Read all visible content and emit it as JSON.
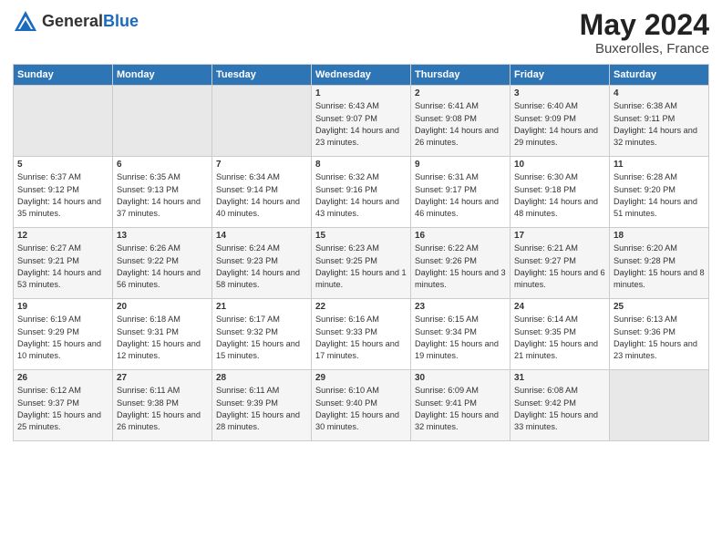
{
  "header": {
    "logo_general": "General",
    "logo_blue": "Blue",
    "month": "May 2024",
    "location": "Buxerolles, France"
  },
  "days_of_week": [
    "Sunday",
    "Monday",
    "Tuesday",
    "Wednesday",
    "Thursday",
    "Friday",
    "Saturday"
  ],
  "weeks": [
    [
      {
        "day": "",
        "sunrise": "",
        "sunset": "",
        "daylight": "",
        "empty": true
      },
      {
        "day": "",
        "sunrise": "",
        "sunset": "",
        "daylight": "",
        "empty": true
      },
      {
        "day": "",
        "sunrise": "",
        "sunset": "",
        "daylight": "",
        "empty": true
      },
      {
        "day": "1",
        "sunrise": "Sunrise: 6:43 AM",
        "sunset": "Sunset: 9:07 PM",
        "daylight": "Daylight: 14 hours and 23 minutes."
      },
      {
        "day": "2",
        "sunrise": "Sunrise: 6:41 AM",
        "sunset": "Sunset: 9:08 PM",
        "daylight": "Daylight: 14 hours and 26 minutes."
      },
      {
        "day": "3",
        "sunrise": "Sunrise: 6:40 AM",
        "sunset": "Sunset: 9:09 PM",
        "daylight": "Daylight: 14 hours and 29 minutes."
      },
      {
        "day": "4",
        "sunrise": "Sunrise: 6:38 AM",
        "sunset": "Sunset: 9:11 PM",
        "daylight": "Daylight: 14 hours and 32 minutes."
      }
    ],
    [
      {
        "day": "5",
        "sunrise": "Sunrise: 6:37 AM",
        "sunset": "Sunset: 9:12 PM",
        "daylight": "Daylight: 14 hours and 35 minutes."
      },
      {
        "day": "6",
        "sunrise": "Sunrise: 6:35 AM",
        "sunset": "Sunset: 9:13 PM",
        "daylight": "Daylight: 14 hours and 37 minutes."
      },
      {
        "day": "7",
        "sunrise": "Sunrise: 6:34 AM",
        "sunset": "Sunset: 9:14 PM",
        "daylight": "Daylight: 14 hours and 40 minutes."
      },
      {
        "day": "8",
        "sunrise": "Sunrise: 6:32 AM",
        "sunset": "Sunset: 9:16 PM",
        "daylight": "Daylight: 14 hours and 43 minutes."
      },
      {
        "day": "9",
        "sunrise": "Sunrise: 6:31 AM",
        "sunset": "Sunset: 9:17 PM",
        "daylight": "Daylight: 14 hours and 46 minutes."
      },
      {
        "day": "10",
        "sunrise": "Sunrise: 6:30 AM",
        "sunset": "Sunset: 9:18 PM",
        "daylight": "Daylight: 14 hours and 48 minutes."
      },
      {
        "day": "11",
        "sunrise": "Sunrise: 6:28 AM",
        "sunset": "Sunset: 9:20 PM",
        "daylight": "Daylight: 14 hours and 51 minutes."
      }
    ],
    [
      {
        "day": "12",
        "sunrise": "Sunrise: 6:27 AM",
        "sunset": "Sunset: 9:21 PM",
        "daylight": "Daylight: 14 hours and 53 minutes."
      },
      {
        "day": "13",
        "sunrise": "Sunrise: 6:26 AM",
        "sunset": "Sunset: 9:22 PM",
        "daylight": "Daylight: 14 hours and 56 minutes."
      },
      {
        "day": "14",
        "sunrise": "Sunrise: 6:24 AM",
        "sunset": "Sunset: 9:23 PM",
        "daylight": "Daylight: 14 hours and 58 minutes."
      },
      {
        "day": "15",
        "sunrise": "Sunrise: 6:23 AM",
        "sunset": "Sunset: 9:25 PM",
        "daylight": "Daylight: 15 hours and 1 minute."
      },
      {
        "day": "16",
        "sunrise": "Sunrise: 6:22 AM",
        "sunset": "Sunset: 9:26 PM",
        "daylight": "Daylight: 15 hours and 3 minutes."
      },
      {
        "day": "17",
        "sunrise": "Sunrise: 6:21 AM",
        "sunset": "Sunset: 9:27 PM",
        "daylight": "Daylight: 15 hours and 6 minutes."
      },
      {
        "day": "18",
        "sunrise": "Sunrise: 6:20 AM",
        "sunset": "Sunset: 9:28 PM",
        "daylight": "Daylight: 15 hours and 8 minutes."
      }
    ],
    [
      {
        "day": "19",
        "sunrise": "Sunrise: 6:19 AM",
        "sunset": "Sunset: 9:29 PM",
        "daylight": "Daylight: 15 hours and 10 minutes."
      },
      {
        "day": "20",
        "sunrise": "Sunrise: 6:18 AM",
        "sunset": "Sunset: 9:31 PM",
        "daylight": "Daylight: 15 hours and 12 minutes."
      },
      {
        "day": "21",
        "sunrise": "Sunrise: 6:17 AM",
        "sunset": "Sunset: 9:32 PM",
        "daylight": "Daylight: 15 hours and 15 minutes."
      },
      {
        "day": "22",
        "sunrise": "Sunrise: 6:16 AM",
        "sunset": "Sunset: 9:33 PM",
        "daylight": "Daylight: 15 hours and 17 minutes."
      },
      {
        "day": "23",
        "sunrise": "Sunrise: 6:15 AM",
        "sunset": "Sunset: 9:34 PM",
        "daylight": "Daylight: 15 hours and 19 minutes."
      },
      {
        "day": "24",
        "sunrise": "Sunrise: 6:14 AM",
        "sunset": "Sunset: 9:35 PM",
        "daylight": "Daylight: 15 hours and 21 minutes."
      },
      {
        "day": "25",
        "sunrise": "Sunrise: 6:13 AM",
        "sunset": "Sunset: 9:36 PM",
        "daylight": "Daylight: 15 hours and 23 minutes."
      }
    ],
    [
      {
        "day": "26",
        "sunrise": "Sunrise: 6:12 AM",
        "sunset": "Sunset: 9:37 PM",
        "daylight": "Daylight: 15 hours and 25 minutes."
      },
      {
        "day": "27",
        "sunrise": "Sunrise: 6:11 AM",
        "sunset": "Sunset: 9:38 PM",
        "daylight": "Daylight: 15 hours and 26 minutes."
      },
      {
        "day": "28",
        "sunrise": "Sunrise: 6:11 AM",
        "sunset": "Sunset: 9:39 PM",
        "daylight": "Daylight: 15 hours and 28 minutes."
      },
      {
        "day": "29",
        "sunrise": "Sunrise: 6:10 AM",
        "sunset": "Sunset: 9:40 PM",
        "daylight": "Daylight: 15 hours and 30 minutes."
      },
      {
        "day": "30",
        "sunrise": "Sunrise: 6:09 AM",
        "sunset": "Sunset: 9:41 PM",
        "daylight": "Daylight: 15 hours and 32 minutes."
      },
      {
        "day": "31",
        "sunrise": "Sunrise: 6:08 AM",
        "sunset": "Sunset: 9:42 PM",
        "daylight": "Daylight: 15 hours and 33 minutes."
      },
      {
        "day": "",
        "sunrise": "",
        "sunset": "",
        "daylight": "",
        "empty": true
      }
    ]
  ]
}
